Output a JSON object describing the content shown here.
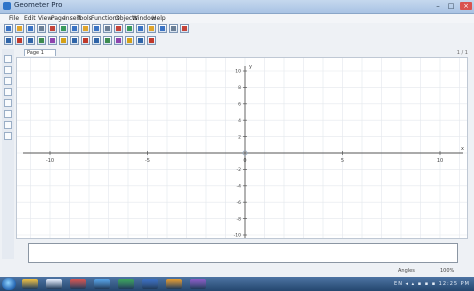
{
  "window": {
    "title": "Geometer Pro"
  },
  "menu": [
    "File",
    "Edit",
    "View",
    "Page",
    "Insert",
    "Tools",
    "Functions",
    "Objects",
    "Window",
    "Help"
  ],
  "toolbar_row1": [
    "new-icon",
    "open-icon",
    "save-icon",
    "print-icon",
    "cut-icon",
    "copy-icon",
    "paste-icon",
    "undo-icon",
    "redo-icon",
    "zoom-in-icon",
    "zoom-out-icon",
    "table-icon",
    "text-icon",
    "image-icon",
    "link-icon",
    "line-icon",
    "help-icon"
  ],
  "toolbar_row2": [
    "point-tool-icon",
    "segment-tool-icon",
    "line-tool-icon",
    "ray-tool-icon",
    "circle-tool-icon",
    "polygon-tool-icon",
    "arc-tool-icon",
    "function-tool-icon",
    "graph-tool-icon",
    "angle-tool-icon",
    "measure-tool-icon",
    "transform-tool-icon",
    "label-tool-icon",
    "grid-tool-icon"
  ],
  "left_tools": [
    "select-tool-icon",
    "pen-tool-icon",
    "highlighter-tool-icon",
    "eraser-tool-icon",
    "zoom-tool-icon",
    "magnify-tool-icon",
    "hand-tool-icon",
    "settings-tool-icon"
  ],
  "page_tab": "Page 1",
  "scroll_indicator": "1 / 1",
  "graph": {
    "x_ticks": [
      "-10",
      "-5",
      "0",
      "5",
      "10"
    ],
    "y_ticks": [
      "10",
      "8",
      "6",
      "4",
      "2",
      "-2",
      "-4",
      "-6",
      "-8",
      "-10"
    ],
    "x_axis_label": "x",
    "y_axis_label": "y"
  },
  "input": {
    "value": ""
  },
  "status": {
    "left": "Angles",
    "right": "100%"
  },
  "taskbar": {
    "apps": [
      "explorer-icon",
      "media-player-icon",
      "paint-icon",
      "browser-icon",
      "spreadsheet-icon",
      "word-icon",
      "email-icon",
      "geometer-icon"
    ],
    "tray_text": "EN ◂ ▴ ▪ ▪ ▪ 12:25 PM"
  },
  "colors": {
    "titlebar": "#a9c3e4",
    "taskbar": "#24466e",
    "grid": "#e3e7ec",
    "axis": "#555555"
  }
}
